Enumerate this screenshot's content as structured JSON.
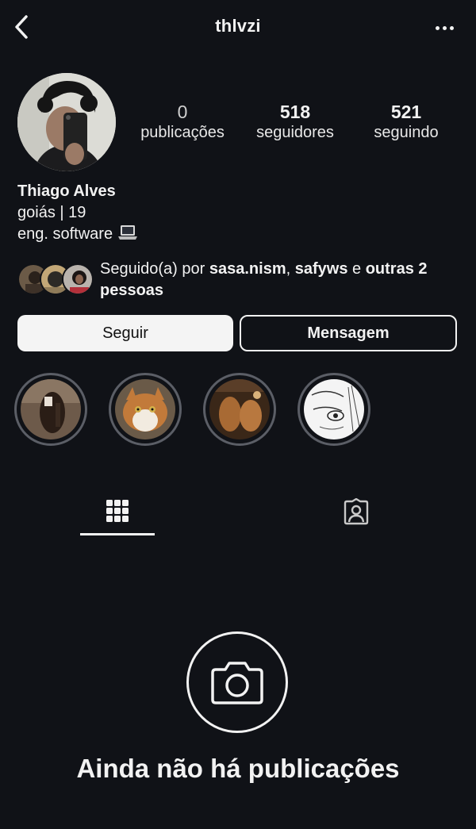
{
  "header": {
    "username": "thlvzi",
    "back_icon": "chevron-left-icon",
    "more_icon": "more-horizontal-icon"
  },
  "profile": {
    "stats": {
      "posts_count": "0",
      "posts_label": "publicações",
      "followers_count": "518",
      "followers_label": "seguidores",
      "following_count": "521",
      "following_label": "seguindo"
    },
    "name": "Thiago Alves",
    "bio_line1": "goiás | 19",
    "bio_line2": "eng. software",
    "bio_emoji": "laptop-icon"
  },
  "followed_by": {
    "prefix": "Seguido(a) por ",
    "user1": "sasa.nism",
    "separator": ", ",
    "user2": "safyws",
    "connector": " e ",
    "others": "outras 2 pessoas"
  },
  "actions": {
    "follow_label": "Seguir",
    "message_label": "Mensagem"
  },
  "highlights": [
    {
      "id": "highlight-1"
    },
    {
      "id": "highlight-2"
    },
    {
      "id": "highlight-3"
    },
    {
      "id": "highlight-4"
    }
  ],
  "tabs": [
    {
      "icon": "grid-icon",
      "active": true
    },
    {
      "icon": "tagged-person-icon",
      "active": false
    }
  ],
  "empty_state": {
    "icon": "camera-icon",
    "message": "Ainda não há publicações"
  },
  "colors": {
    "background": "#101217",
    "text": "#f2f2f2",
    "follow_button_bg": "#f4f4f4",
    "highlight_ring": "#5b5e66"
  }
}
